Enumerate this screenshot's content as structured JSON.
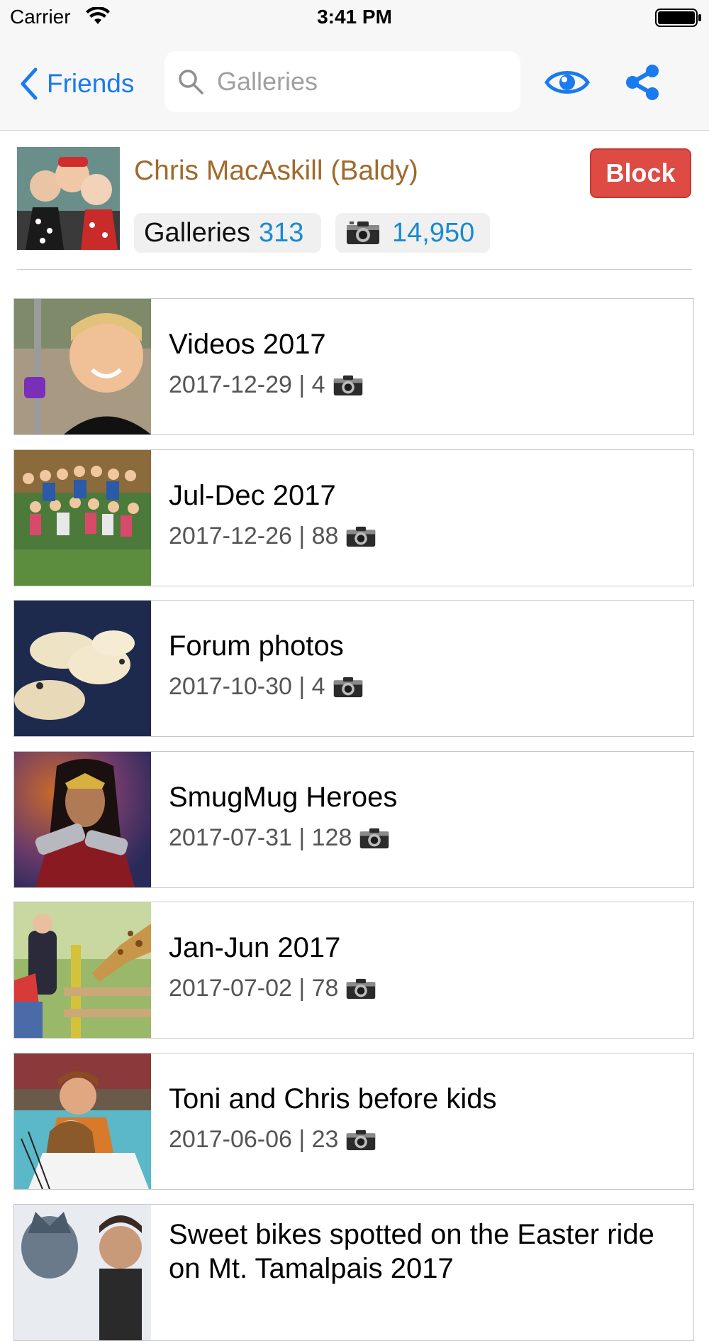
{
  "status_bar": {
    "carrier": "Carrier",
    "time": "3:41 PM"
  },
  "nav": {
    "back_label": "Friends",
    "search_placeholder": "Galleries",
    "search_value": "",
    "icons": [
      "chevron-left-icon",
      "search-icon",
      "eye-icon",
      "share-icon"
    ],
    "accent_color": "#1a7af0"
  },
  "profile": {
    "name": "Chris MacAskill (Baldy)",
    "name_color": "#a06a2c",
    "block_label": "Block",
    "block_color": "#dd4b44",
    "galleries_label": "Galleries",
    "galleries_count": "313",
    "photos_count": "14,950"
  },
  "galleries": [
    {
      "title": "Videos 2017",
      "meta": "2017-12-29 | 4"
    },
    {
      "title": "Jul-Dec 2017",
      "meta": "2017-12-26 | 88"
    },
    {
      "title": "Forum photos",
      "meta": "2017-10-30 | 4"
    },
    {
      "title": "SmugMug Heroes",
      "meta": "2017-07-31 | 128"
    },
    {
      "title": "Jan-Jun 2017",
      "meta": "2017-07-02 | 78"
    },
    {
      "title": "Toni and Chris before kids",
      "meta": "2017-06-06 | 23"
    },
    {
      "title": "Sweet bikes spotted on the Easter ride on Mt. Tamalpais 2017",
      "meta": ""
    }
  ]
}
